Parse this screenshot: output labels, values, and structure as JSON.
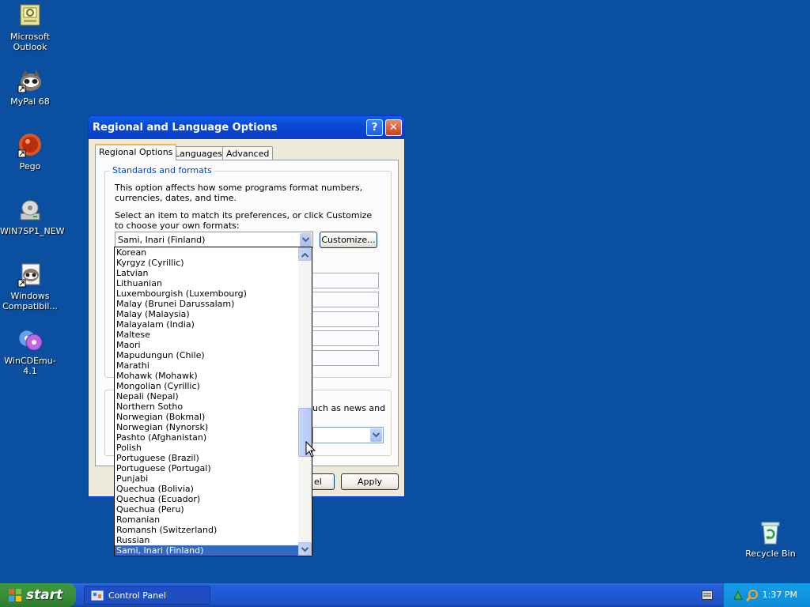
{
  "desktop": {
    "icons": [
      {
        "label": "Microsoft Outlook",
        "icon": "outlook-icon"
      },
      {
        "label": "MyPal 68",
        "icon": "mypal-icon"
      },
      {
        "label": "Pego",
        "icon": "pego-icon"
      },
      {
        "label": "WIN7SP1_NEW",
        "icon": "cd-drive-icon"
      },
      {
        "label": "Windows Compatibil...",
        "icon": "compatibility-icon"
      },
      {
        "label": "WinCDEmu-4.1",
        "icon": "wincdemu-icon"
      },
      {
        "label": "Recycle Bin",
        "icon": "recycle-bin-icon"
      }
    ]
  },
  "dialog": {
    "title": "Regional and Language Options",
    "help_glyph": "?",
    "close_glyph": "✕",
    "tabs": [
      "Regional Options",
      "Languages",
      "Advanced"
    ],
    "group_standards": {
      "title": "Standards and formats",
      "description": "This option affects how some programs format numbers, currencies, dates, and time.",
      "instruction": "Select an item to match its preferences, or click Customize to choose your own formats:",
      "selected_format": "Sami, Inari (Finland)",
      "customize_label": "Customize..."
    },
    "group_location_partial": {
      "visible_text": "uch as news and"
    },
    "buttons": {
      "cancel_partial": "el",
      "apply": "Apply"
    }
  },
  "dropdown": {
    "items": [
      "Korean",
      "Kyrgyz (Cyrillic)",
      "Latvian",
      "Lithuanian",
      "Luxembourgish (Luxembourg)",
      "Malay (Brunei Darussalam)",
      "Malay (Malaysia)",
      "Malayalam (India)",
      "Maltese",
      "Maori",
      "Mapudungun (Chile)",
      "Marathi",
      "Mohawk (Mohawk)",
      "Mongolian (Cyrillic)",
      "Nepali (Nepal)",
      "Northern Sotho",
      "Norwegian (Bokmal)",
      "Norwegian (Nynorsk)",
      "Pashto (Afghanistan)",
      "Polish",
      "Portuguese (Brazil)",
      "Portuguese (Portugal)",
      "Punjabi",
      "Quechua (Bolivia)",
      "Quechua (Ecuador)",
      "Quechua (Peru)",
      "Romanian",
      "Romansh (Switzerland)",
      "Russian",
      "Sami, Inari (Finland)"
    ],
    "selected": "Sami, Inari (Finland)"
  },
  "taskbar": {
    "start_label": "start",
    "task_label": "Control Panel",
    "clock": "1:37 PM"
  },
  "colors": {
    "desktop": "#0a4fa0",
    "selection": "#316ac5",
    "titlebar": "#0a48d4"
  }
}
